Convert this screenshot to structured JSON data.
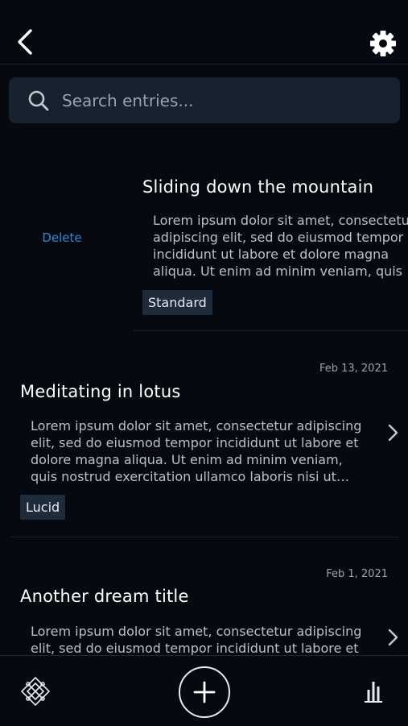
{
  "header": {
    "back_icon": "chevron-left-icon",
    "settings_icon": "gear-icon"
  },
  "search": {
    "placeholder": "Search entries...",
    "icon": "search-icon"
  },
  "swiped_entry": {
    "delete_label": "Delete",
    "title": "Sliding down the mountain",
    "excerpt": "Lorem ipsum dolor sit amet, consectetur adipiscing elit, sed do eiusmod tempor incididunt ut labore et dolore magna aliqua. Ut enim ad minim veniam, quis nostrud exercitation ullamco...",
    "tag": "Standard"
  },
  "entries": [
    {
      "date": "Feb 13, 2021",
      "title": "Meditating in lotus",
      "excerpt": "Lorem ipsum dolor sit amet, consectetur adipiscing elit, sed do eiusmod tempor incididunt ut labore et dolore magna aliqua. Ut enim ad minim veniam, quis nostrud exercitation ullamco laboris nisi ut aliquip",
      "tag": "Lucid"
    },
    {
      "date": "Feb 1, 2021",
      "title": "Another dream title",
      "excerpt": "Lorem ipsum dolor sit amet, consectetur adipiscing elit, sed do eiusmod tempor incididunt ut labore et dolore magna aliqua.",
      "tag": ""
    }
  ],
  "bottom_nav": {
    "logo_icon": "lotus-logo-icon",
    "add_icon": "plus-icon",
    "stats_icon": "bar-chart-icon"
  },
  "colors": {
    "background": "#060a10",
    "search_bg": "#18222e",
    "tag_bg": "#1e2b3b",
    "delete": "#2f86d6"
  }
}
